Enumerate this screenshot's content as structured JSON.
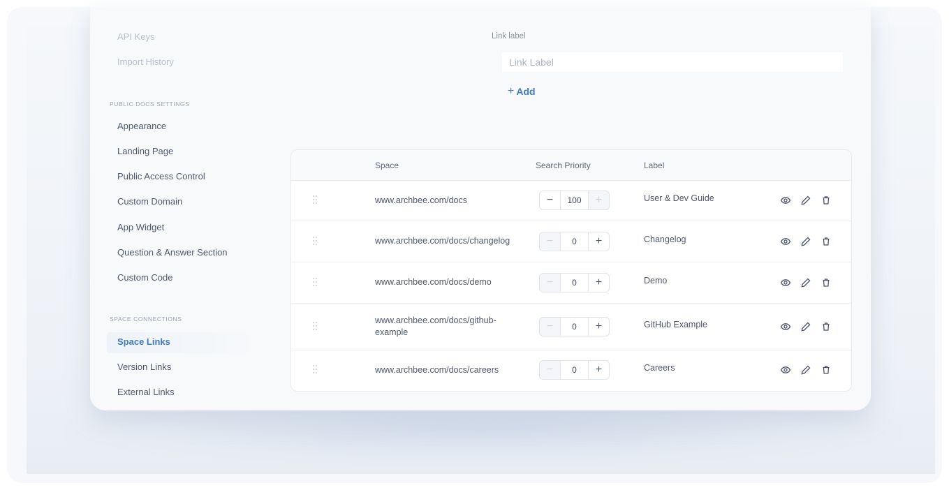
{
  "sidebar": {
    "top_items": [
      {
        "label": "API Keys"
      },
      {
        "label": "Import History"
      }
    ],
    "public_docs_section": "PUBLIC DOCS SETTINGS",
    "public_docs_items": [
      {
        "label": "Appearance"
      },
      {
        "label": "Landing Page"
      },
      {
        "label": "Public Access Control"
      },
      {
        "label": "Custom Domain"
      },
      {
        "label": "App Widget"
      },
      {
        "label": "Question & Answer Section"
      },
      {
        "label": "Custom Code"
      }
    ],
    "space_connections_section": "SPACE CONNECTIONS",
    "space_connections_items": [
      {
        "label": "Space Links",
        "active": true
      },
      {
        "label": "Version Links"
      },
      {
        "label": "External Links"
      }
    ]
  },
  "form": {
    "link_label_caption": "Link label",
    "link_label_placeholder": "Link Label",
    "link_label_value": "",
    "add_label": "Add",
    "add_symbol": "+"
  },
  "table": {
    "headers": {
      "space": "Space",
      "search_priority": "Search Priority",
      "label": "Label"
    },
    "rows": [
      {
        "space": "www.archbee.com/docs",
        "priority": "100",
        "label": "User & Dev Guide",
        "minus_enabled": true,
        "plus_enabled": false
      },
      {
        "space": "www.archbee.com/docs/changelog",
        "priority": "0",
        "label": "Changelog",
        "minus_enabled": false,
        "plus_enabled": true
      },
      {
        "space": "www.archbee.com/docs/demo",
        "priority": "0",
        "label": "Demo",
        "minus_enabled": false,
        "plus_enabled": true
      },
      {
        "space": "www.archbee.com/docs/github-example",
        "priority": "0",
        "label": "GitHub Example",
        "minus_enabled": false,
        "plus_enabled": true
      },
      {
        "space": "www.archbee.com/docs/careers",
        "priority": "0",
        "label": "Careers",
        "minus_enabled": false,
        "plus_enabled": true
      }
    ],
    "stepper_minus": "−",
    "stepper_plus": "+",
    "row_icons": [
      "eye-icon",
      "pencil-icon",
      "trash-icon"
    ]
  },
  "colors": {
    "accent": "#3e7bc1",
    "text": "#4d586b",
    "muted": "#9aa3b0"
  }
}
